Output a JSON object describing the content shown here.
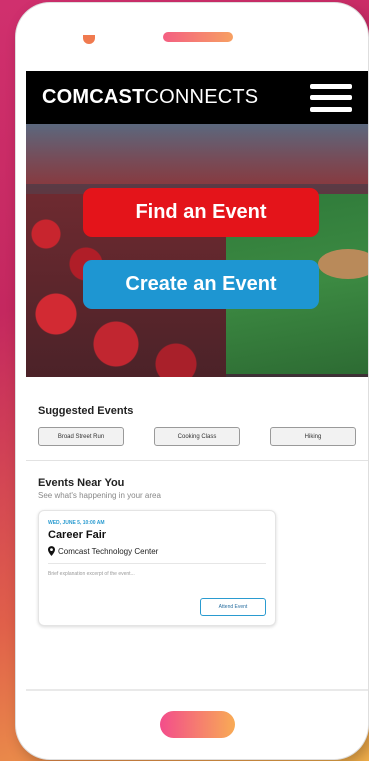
{
  "brand": {
    "bold": "COMCAST",
    "regular": "CONNECTS"
  },
  "hero": {
    "find_label": "Find an Event",
    "create_label": "Create an Event"
  },
  "suggested": {
    "title": "Suggested Events",
    "chips": [
      "Broad Street Run",
      "Cooking Class",
      "Hiking"
    ]
  },
  "near": {
    "title": "Events Near You",
    "subtitle": "See what's happening in your area",
    "card": {
      "date": "WED, JUNE 5, 10:00 AM",
      "title": "Career Fair",
      "location": "Comcast Technology Center",
      "description": "Brief explanation excerpt of the event...",
      "attend_label": "Attend Event"
    }
  },
  "colors": {
    "find": "#e4141a",
    "create": "#1e96d2",
    "accent": "#2a9bd0"
  },
  "icons": {
    "menu": "hamburger-menu-icon",
    "location": "map-pin-icon"
  }
}
